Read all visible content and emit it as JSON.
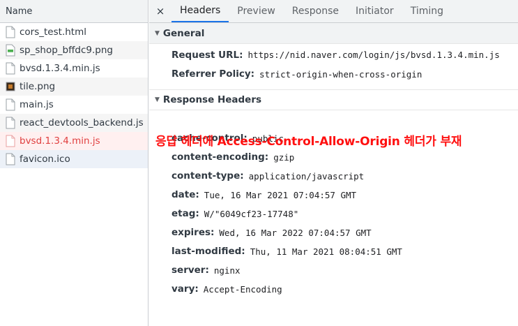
{
  "request_list": {
    "header": "Name",
    "items": [
      {
        "label": "cors_test.html",
        "icon": "document-icon"
      },
      {
        "label": "sp_shop_bffdc9.png",
        "icon": "image-icon"
      },
      {
        "label": "bvsd.1.3.4.min.js",
        "icon": "script-icon"
      },
      {
        "label": "tile.png",
        "icon": "image-icon"
      },
      {
        "label": "main.js",
        "icon": "script-icon"
      },
      {
        "label": "react_devtools_backend.js",
        "icon": "script-icon"
      },
      {
        "label": "bvsd.1.3.4.min.js",
        "icon": "script-icon",
        "status": "error"
      },
      {
        "label": "favicon.ico",
        "icon": "document-icon",
        "status": "selected"
      }
    ]
  },
  "tabs": {
    "close": "×",
    "items": [
      "Headers",
      "Preview",
      "Response",
      "Initiator",
      "Timing"
    ],
    "active": "Headers"
  },
  "general": {
    "title": "General",
    "request_url_label": "Request URL:",
    "request_url": "https://nid.naver.com/login/js/bvsd.1.3.4.min.js",
    "referrer_policy_label": "Referrer Policy:",
    "referrer_policy": "strict-origin-when-cross-origin"
  },
  "response_headers": {
    "title": "Response Headers",
    "items": [
      {
        "key": "cache-control:",
        "value": "public"
      },
      {
        "key": "content-encoding:",
        "value": "gzip"
      },
      {
        "key": "content-type:",
        "value": "application/javascript"
      },
      {
        "key": "date:",
        "value": "Tue, 16 Mar 2021 07:04:57 GMT"
      },
      {
        "key": "etag:",
        "value": "W/\"6049cf23-17748\""
      },
      {
        "key": "expires:",
        "value": "Wed, 16 Mar 2022 07:04:57 GMT"
      },
      {
        "key": "last-modified:",
        "value": "Thu, 11 Mar 2021 08:04:51 GMT"
      },
      {
        "key": "server:",
        "value": "nginx"
      },
      {
        "key": "vary:",
        "value": "Accept-Encoding"
      }
    ]
  },
  "annotation": "응답 헤더에 Access-Control-Allow-Origin 헤더가 부재",
  "colors": {
    "accent": "#1a73e8",
    "error_text": "#e04040",
    "annotation": "#ff1010"
  }
}
